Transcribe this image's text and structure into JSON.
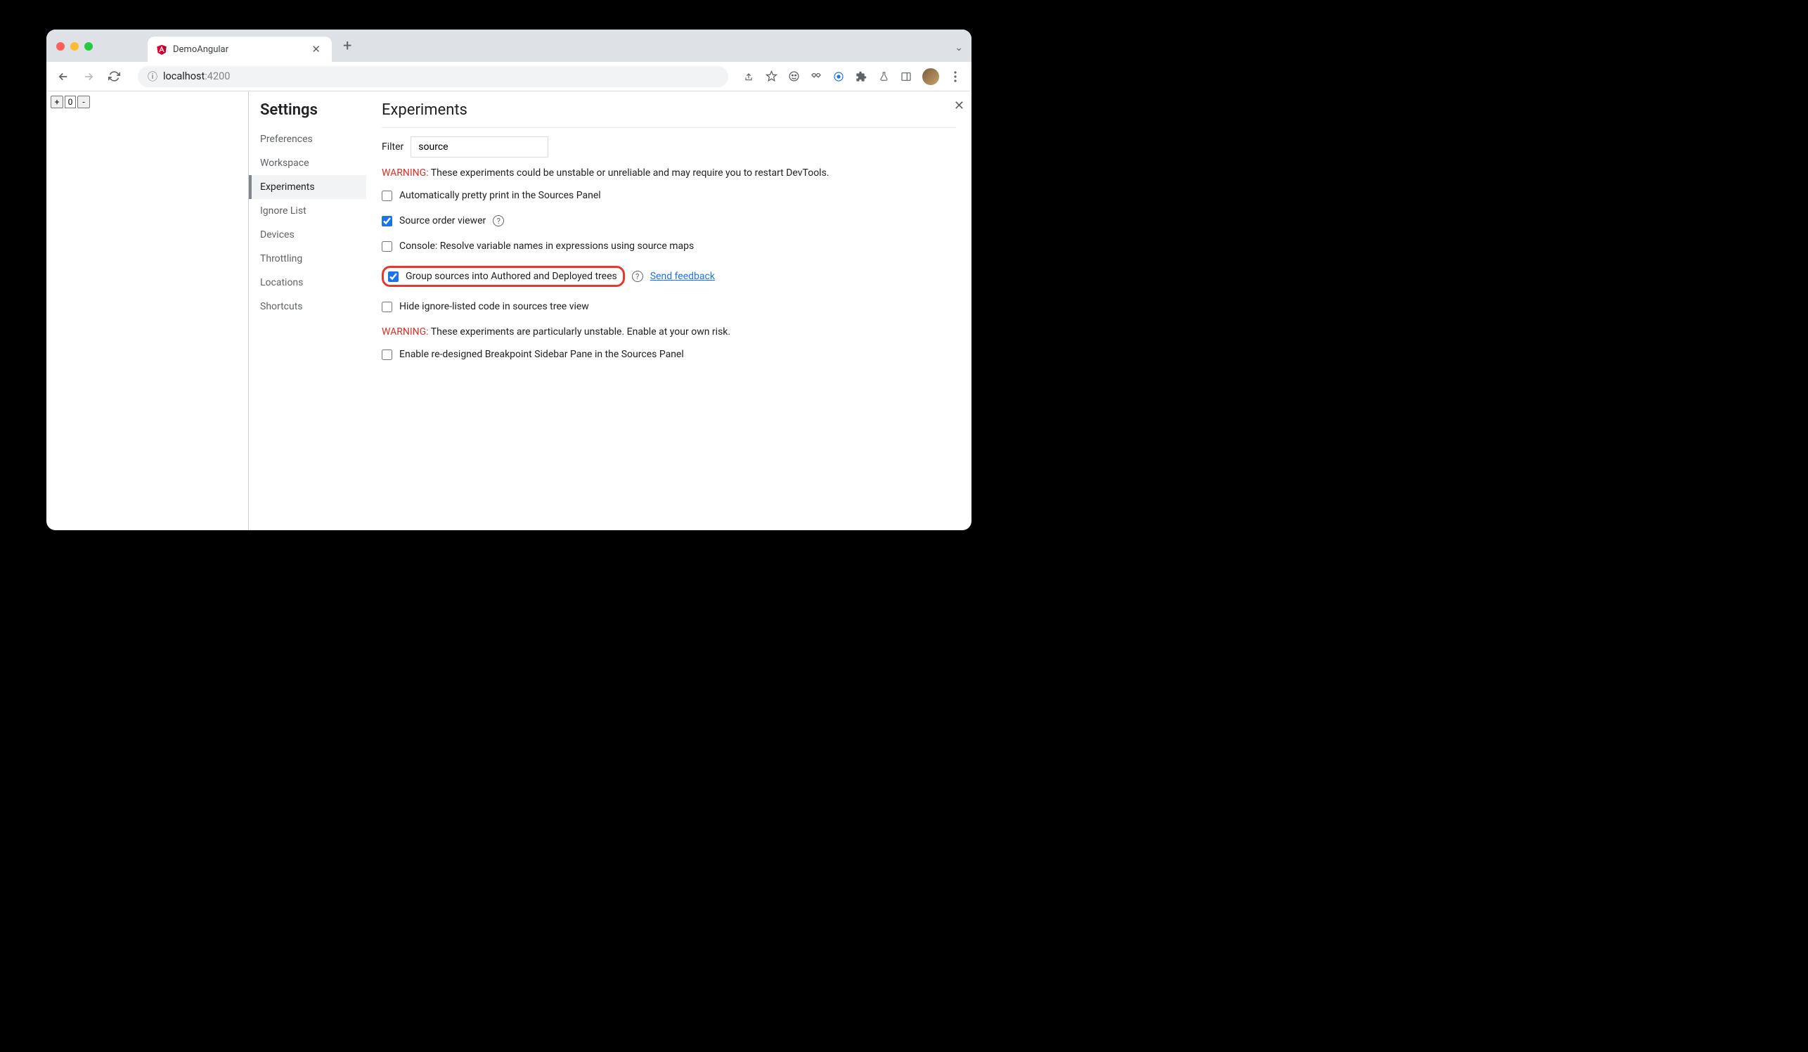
{
  "tab": {
    "title": "DemoAngular"
  },
  "url": {
    "host": "localhost",
    "port": ":4200"
  },
  "page": {
    "counter_value": "0"
  },
  "settings": {
    "heading": "Settings",
    "nav": {
      "preferences": "Preferences",
      "workspace": "Workspace",
      "experiments": "Experiments",
      "ignore_list": "Ignore List",
      "devices": "Devices",
      "throttling": "Throttling",
      "locations": "Locations",
      "shortcuts": "Shortcuts"
    }
  },
  "experiments": {
    "heading": "Experiments",
    "filter_label": "Filter",
    "filter_value": "source",
    "warning1_prefix": "WARNING:",
    "warning1_text": " These experiments could be unstable or unreliable and may require you to restart DevTools.",
    "items": {
      "pretty_print": {
        "label": "Automatically pretty print in the Sources Panel",
        "checked": false
      },
      "source_order": {
        "label": "Source order viewer",
        "checked": true
      },
      "console_sourcemaps": {
        "label": "Console: Resolve variable names in expressions using source maps",
        "checked": false
      },
      "group_sources": {
        "label": "Group sources into Authored and Deployed trees",
        "checked": true,
        "feedback": "Send feedback"
      },
      "hide_ignored": {
        "label": "Hide ignore-listed code in sources tree view",
        "checked": false
      }
    },
    "warning2_prefix": "WARNING:",
    "warning2_text": " These experiments are particularly unstable. Enable at your own risk.",
    "items2": {
      "breakpoint_sidebar": {
        "label": "Enable re-designed Breakpoint Sidebar Pane in the Sources Panel",
        "checked": false
      }
    }
  }
}
